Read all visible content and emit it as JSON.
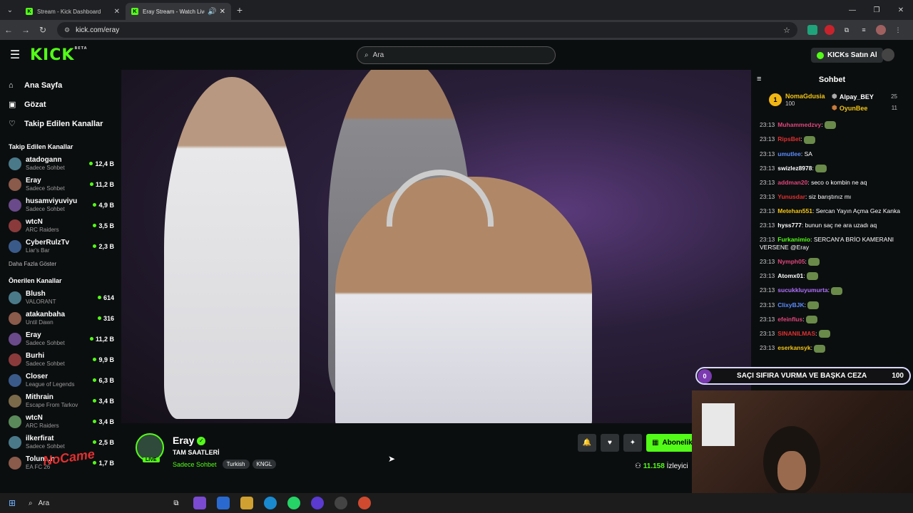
{
  "browser": {
    "tabs": [
      {
        "title": "Stream - Kick Dashboard"
      },
      {
        "title": "Eray Stream - Watch Live o"
      }
    ],
    "url": "kick.com/eray"
  },
  "header": {
    "logo": "KICK",
    "logo_badge": "BETA",
    "search_placeholder": "Ara",
    "kicks_button": "KICKs Satın Al"
  },
  "sidebar": {
    "nav": [
      {
        "label": "Ana Sayfa",
        "icon": "home-icon"
      },
      {
        "label": "Gözat",
        "icon": "browse-icon"
      },
      {
        "label": "Takip Edilen Kanallar",
        "icon": "heart-icon"
      }
    ],
    "followed_title": "Takip Edilen Kanallar",
    "followed": [
      {
        "name": "atadogann",
        "category": "Sadece Sohbet",
        "viewers": "12,4 B"
      },
      {
        "name": "Eray",
        "category": "Sadece Sohbet",
        "viewers": "11,2 B"
      },
      {
        "name": "husamviyuviyu",
        "category": "Sadece Sohbet",
        "viewers": "4,9 B"
      },
      {
        "name": "wtcN",
        "category": "ARC Raiders",
        "viewers": "3,5 B"
      },
      {
        "name": "CyberRulzTv",
        "category": "Liar's Bar",
        "viewers": "2,3 B"
      }
    ],
    "show_more": "Daha Fazla Göster",
    "recommended_title": "Önerilen Kanallar",
    "recommended": [
      {
        "name": "Blush",
        "category": "VALORANT",
        "viewers": "614"
      },
      {
        "name": "atakanbaha",
        "category": "Until Dawn",
        "viewers": "316"
      },
      {
        "name": "Eray",
        "category": "Sadece Sohbet",
        "viewers": "11,2 B"
      },
      {
        "name": "Burhi",
        "category": "Sadece Sohbet",
        "viewers": "9,9 B"
      },
      {
        "name": "Closer",
        "category": "League of Legends",
        "viewers": "6,3 B"
      },
      {
        "name": "Mithrain",
        "category": "Escape From Tarkov",
        "viewers": "3,4 B"
      },
      {
        "name": "wtcN",
        "category": "ARC Raiders",
        "viewers": "3,4 B"
      },
      {
        "name": "ilkerfirat",
        "category": "Sadece Sohbet",
        "viewers": "2,5 B"
      },
      {
        "name": "Tolun...n",
        "category": "EA FC 26",
        "viewers": "1,7 B"
      }
    ]
  },
  "stream": {
    "name": "Eray",
    "live_label": "LIVE",
    "title": "TAM SAATLERİ",
    "category": "Sadece Sohbet",
    "tags": [
      "Turkish",
      "KNGL"
    ],
    "subscribe_label": "Abonelik",
    "viewers": "11.158",
    "viewers_label": "İzleyici"
  },
  "chat": {
    "title": "Sohbet",
    "leaderboard": {
      "first": {
        "rank": "1",
        "name": "NomaGdusia",
        "value": "100"
      },
      "others": [
        {
          "name": "Alpay_BEY",
          "value": "25",
          "color": "#ffffff"
        },
        {
          "name": "OyunBee",
          "value": "11",
          "color": "#f2c514"
        }
      ]
    },
    "messages": [
      {
        "time": "23:13",
        "user": "Muhammedzvy",
        "color": "#e0457b",
        "text": "",
        "emote": true
      },
      {
        "time": "23:13",
        "user": "RipsBet",
        "color": "#e03030",
        "text": "",
        "emote": true
      },
      {
        "time": "23:13",
        "user": "umutlee",
        "color": "#5b8cff",
        "text": "SA",
        "emote": false
      },
      {
        "time": "23:13",
        "user": "swizlez8978",
        "color": "#ffffff",
        "text": "",
        "emote": true
      },
      {
        "time": "23:13",
        "user": "addman20",
        "color": "#e0457b",
        "text": "seco o kombin ne aq",
        "emote": false
      },
      {
        "time": "23:13",
        "user": "Yunusdar",
        "color": "#e03030",
        "text": "siz barıştınız mı",
        "emote": false
      },
      {
        "time": "23:13",
        "user": "Metehan551",
        "color": "#f2c514",
        "text": "Sercan Yayın Açma Gez Kanka",
        "emote": false
      },
      {
        "time": "23:13",
        "user": "hyss777",
        "color": "#ffffff",
        "text": "bunun saç ne ara uzadı aq",
        "emote": false
      },
      {
        "time": "23:13",
        "user": "Furkanimio",
        "color": "#53fc18",
        "text": "SERCAN'A BRİO KAMERANI VERSENE @Eray",
        "emote": false
      },
      {
        "time": "23:13",
        "user": "Nymph05",
        "color": "#e0457b",
        "text": "",
        "emote": true
      },
      {
        "time": "23:13",
        "user": "Atomx01",
        "color": "#ffffff",
        "text": "",
        "emote": true
      },
      {
        "time": "23:13",
        "user": "sucukkluyumurta",
        "color": "#b070ff",
        "text": "",
        "emote": true
      },
      {
        "time": "23:13",
        "user": "ClixyBJK",
        "color": "#5b8cff",
        "text": "",
        "emote": true
      },
      {
        "time": "23:13",
        "user": "efeinflus",
        "color": "#e0457b",
        "text": "",
        "emote": true
      },
      {
        "time": "23:13",
        "user": "SINANILMAS",
        "color": "#e03030",
        "text": "",
        "emote": true
      },
      {
        "time": "23:13",
        "user": "eserkansyk",
        "color": "#f2c514",
        "text": "",
        "emote": true
      }
    ]
  },
  "overlay": {
    "poll_left": "0",
    "poll_text": "SAÇI SIFIRA VURMA VE BAŞKA CEZA",
    "poll_right": "100",
    "watermark": "NoCame"
  },
  "taskbar": {
    "search_label": "Ara"
  },
  "colors": {
    "kick_green": "#53fc18",
    "background": "#0b0e0f"
  }
}
